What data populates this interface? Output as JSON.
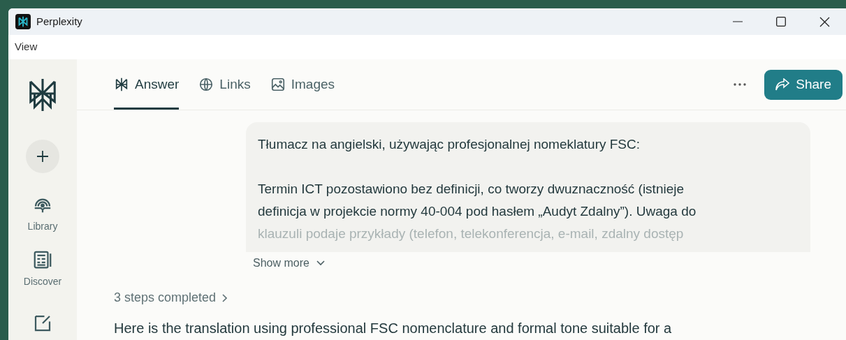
{
  "window": {
    "title": "Perplexity"
  },
  "menu": [
    "View"
  ],
  "sidebar": {
    "items": [
      {
        "label": "Library",
        "kind": "library"
      },
      {
        "label": "Discover",
        "kind": "discover"
      }
    ]
  },
  "tabs": [
    {
      "label": "Answer",
      "kind": "answer",
      "selected": true
    },
    {
      "label": "Links",
      "kind": "links",
      "selected": false
    },
    {
      "label": "Images",
      "kind": "images",
      "selected": false
    }
  ],
  "share_button": "Share",
  "query": {
    "paragraphs": [
      [
        "Tłumacz na angielski, używając profesjonalnej nomeklatury FSC:"
      ],
      [
        "Termin ICT pozostawiono bez definicji, co tworzy dwuznaczność (istnieje",
        "definicja w projekcie normy 40-004 pod hasłem „Audyt Zdalny”). Uwaga do",
        "klauzuli podaje przykłady (telefon, telekonferencja, e-mail, zdalny dostęp"
      ]
    ],
    "show_more": "Show more"
  },
  "steps": "3 steps completed",
  "answer": "Here is the translation using professional FSC nomenclature and formal tone suitable for a"
}
